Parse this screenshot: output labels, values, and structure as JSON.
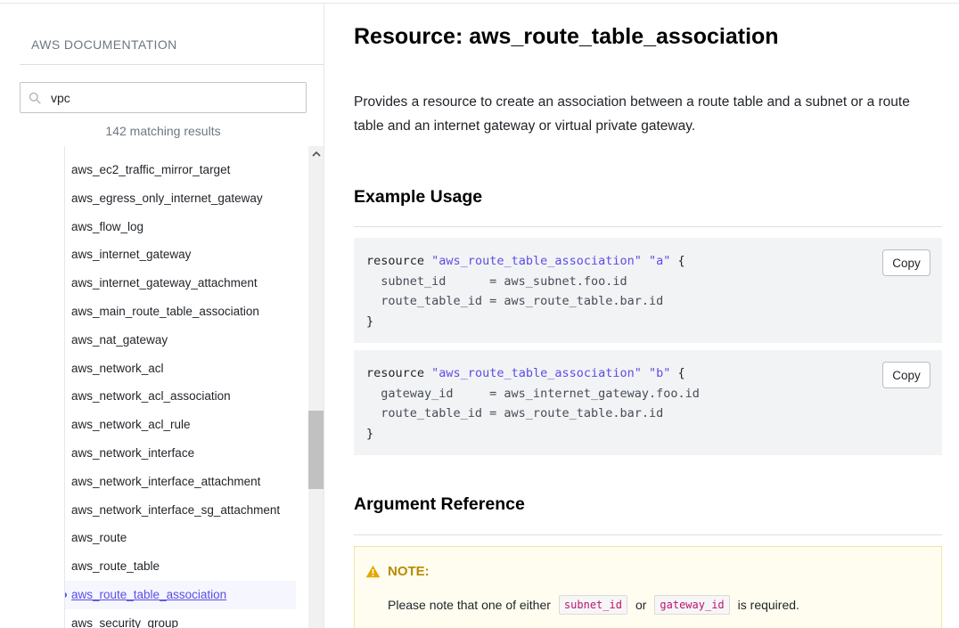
{
  "sidebar": {
    "title": "AWS DOCUMENTATION",
    "search": {
      "value": "vpc",
      "placeholder": ""
    },
    "results_count": "142 matching results",
    "items": [
      "aws_ec2_traffic_mirror_target",
      "aws_egress_only_internet_gateway",
      "aws_flow_log",
      "aws_internet_gateway",
      "aws_internet_gateway_attachment",
      "aws_main_route_table_association",
      "aws_nat_gateway",
      "aws_network_acl",
      "aws_network_acl_association",
      "aws_network_acl_rule",
      "aws_network_interface",
      "aws_network_interface_attachment",
      "aws_network_interface_sg_attachment",
      "aws_route",
      "aws_route_table",
      "aws_route_table_association",
      "aws_security_group"
    ],
    "active_item": "aws_route_table_association"
  },
  "main": {
    "title": "Resource: aws_route_table_association",
    "intro": "Provides a resource to create an association between a route table and a subnet or a route table and an internet gateway or virtual private gateway.",
    "example_heading": "Example Usage",
    "examples": [
      {
        "keyword": "resource",
        "type": "\"aws_route_table_association\"",
        "name": "\"a\"",
        "lines": [
          "  subnet_id      = aws_subnet.foo.id",
          "  route_table_id = aws_route_table.bar.id"
        ],
        "copy_label": "Copy"
      },
      {
        "keyword": "resource",
        "type": "\"aws_route_table_association\"",
        "name": "\"b\"",
        "lines": [
          "  gateway_id     = aws_internet_gateway.foo.id",
          "  route_table_id = aws_route_table.bar.id"
        ],
        "copy_label": "Copy"
      }
    ],
    "argument_heading": "Argument Reference",
    "note": {
      "label": "NOTE:",
      "text_before": "Please note that one of either",
      "code1": "subnet_id",
      "text_mid": "or",
      "code2": "gateway_id",
      "text_after": "is required."
    }
  },
  "colors": {
    "accent": "#5c4ee5",
    "note_label": "#b78b00",
    "inline_code": "#b8166e"
  },
  "icons": {
    "search": "search-icon",
    "scroll_up": "chevron-up-icon",
    "warning": "warning-icon"
  }
}
